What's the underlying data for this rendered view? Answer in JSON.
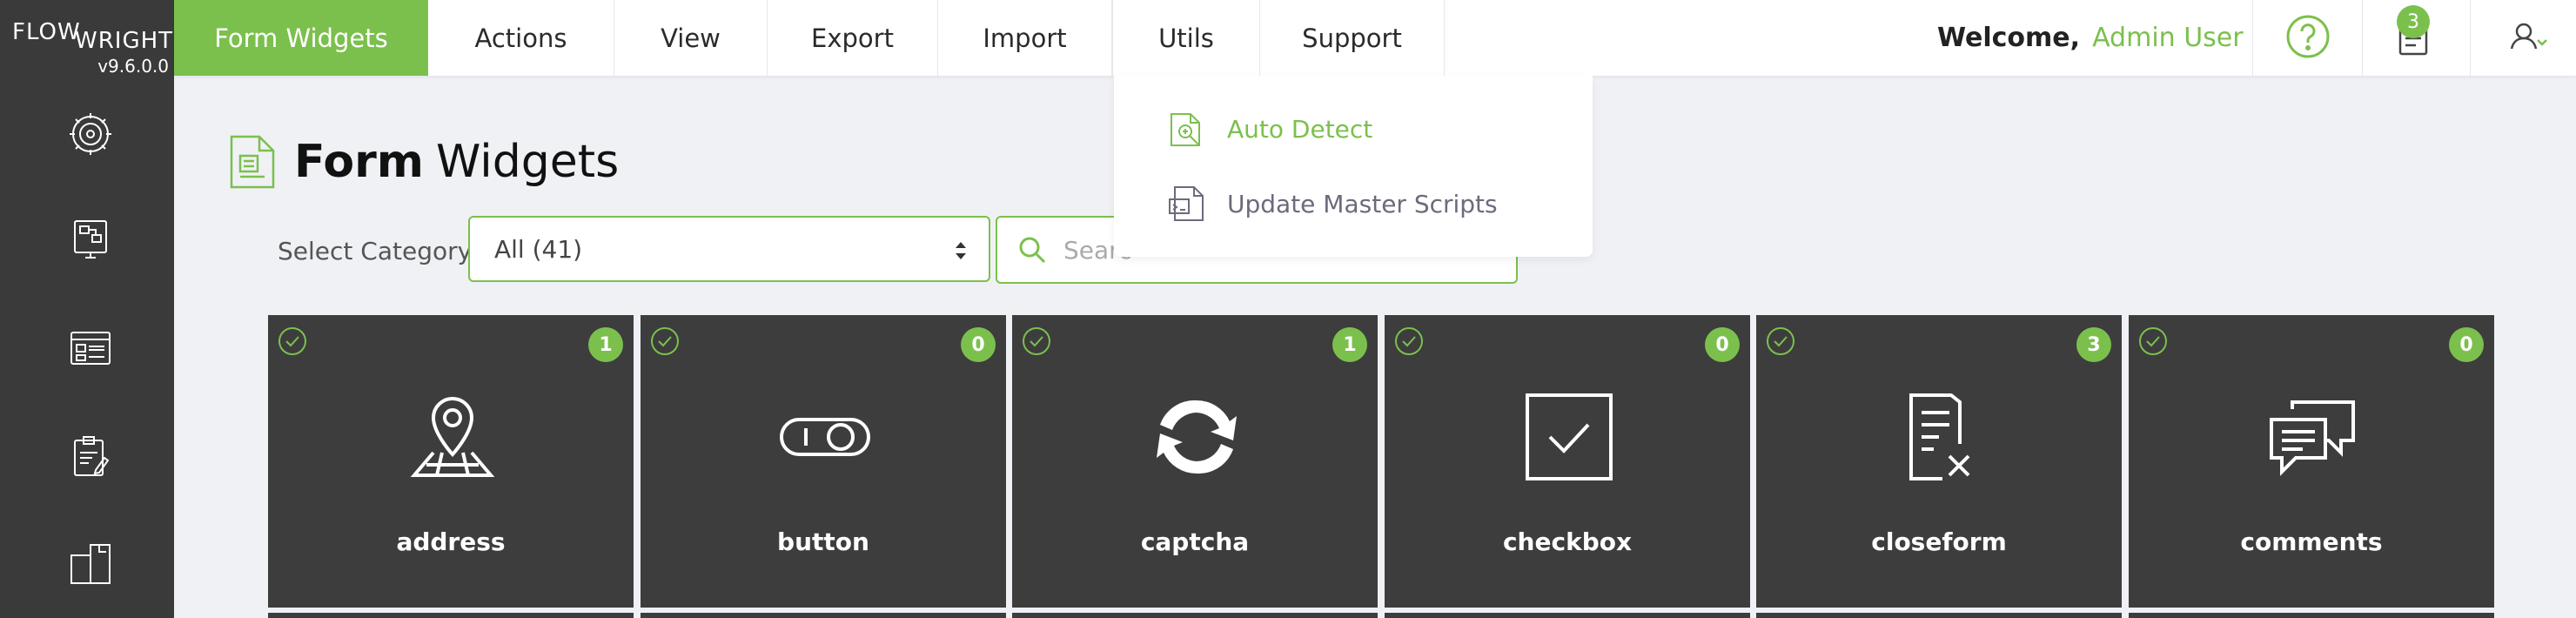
{
  "app": {
    "logo_top": "FLOW",
    "logo_bottom": "WRIGHT",
    "version": "v9.6.0.0"
  },
  "nav": {
    "tabs": [
      {
        "label": "Form Widgets"
      },
      {
        "label": "Actions"
      },
      {
        "label": "View"
      },
      {
        "label": "Export"
      },
      {
        "label": "Import"
      },
      {
        "label": "Utils"
      },
      {
        "label": "Support"
      }
    ],
    "welcome": "Welcome,",
    "user": "Admin User",
    "notification_count": "3"
  },
  "utils_menu": {
    "items": [
      {
        "label": "Auto Detect",
        "icon": "auto-detect-icon"
      },
      {
        "label": "Update Master Scripts",
        "icon": "master-scripts-icon"
      }
    ]
  },
  "page": {
    "title_bold": "Form",
    "title_rest": "Widgets"
  },
  "filter": {
    "label": "Select Category:",
    "selected": "All (41)",
    "search_placeholder": "Search"
  },
  "widgets": [
    {
      "name": "address",
      "count": "1",
      "icon": "map-pin-icon"
    },
    {
      "name": "button",
      "count": "0",
      "icon": "toggle-icon"
    },
    {
      "name": "captcha",
      "count": "1",
      "icon": "refresh-icon"
    },
    {
      "name": "checkbox",
      "count": "0",
      "icon": "checkbox-icon"
    },
    {
      "name": "closeform",
      "count": "3",
      "icon": "close-form-icon"
    },
    {
      "name": "comments",
      "count": "0",
      "icon": "chat-icon"
    }
  ],
  "colors": {
    "accent": "#7bc04d",
    "sidebar": "#3a3a3a",
    "card": "#3d3d3d"
  }
}
